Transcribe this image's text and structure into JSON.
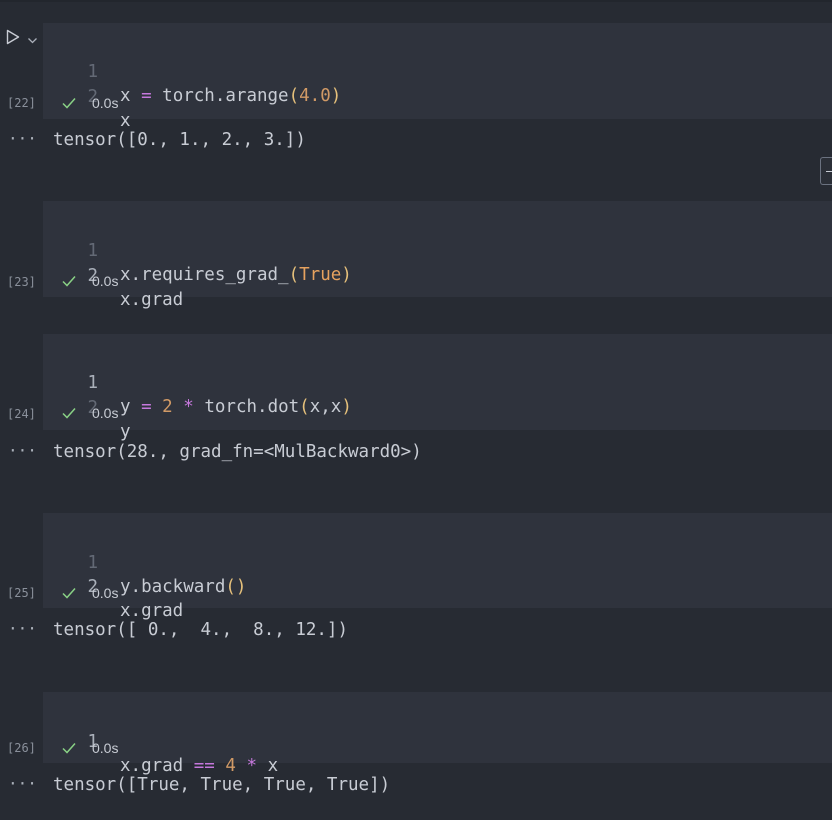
{
  "cells": [
    {
      "exec_count": "[22]",
      "lines": [
        {
          "num": "1",
          "code": "x = torch.arange(4.0)"
        },
        {
          "num": "2",
          "code": "x"
        }
      ],
      "status": "0.0s",
      "output": "tensor([0., 1., 2., 3.])"
    },
    {
      "exec_count": "[23]",
      "lines": [
        {
          "num": "1",
          "code": "x.requires_grad_(True)"
        },
        {
          "num": "2",
          "code": "x.grad"
        }
      ],
      "status": "0.0s",
      "output": ""
    },
    {
      "exec_count": "[24]",
      "lines": [
        {
          "num": "1",
          "code": "y = 2 * torch.dot(x,x)"
        },
        {
          "num": "2",
          "code": "y"
        }
      ],
      "status": "0.0s",
      "output": "tensor(28., grad_fn=<MulBackward0>)"
    },
    {
      "exec_count": "[25]",
      "lines": [
        {
          "num": "1",
          "code": "y.backward()"
        },
        {
          "num": "2",
          "code": "x.grad"
        }
      ],
      "status": "0.0s",
      "output": "tensor([ 0.,  4.,  8., 12.])"
    },
    {
      "exec_count": "[26]",
      "lines": [
        {
          "num": "1",
          "code": "x.grad == 4 * x"
        }
      ],
      "status": "0.0s",
      "output": "tensor([True, True, True, True])"
    }
  ],
  "output_marker": "···",
  "colors": {
    "background": "#272b33",
    "cell_background": "#2f333d",
    "text": "#c8ccd4",
    "operator": "#c678dd",
    "number": "#d19a66",
    "paren": "#e5c07b",
    "success": "#89d185"
  },
  "icons": {
    "run": "run-triangle-icon",
    "run_menu": "chevron-down-icon",
    "status": "check-icon"
  }
}
